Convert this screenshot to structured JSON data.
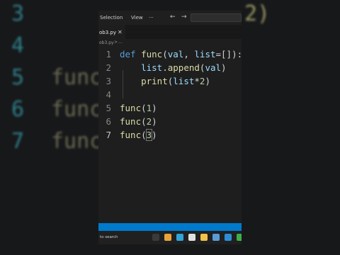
{
  "background": {
    "lines": [
      {
        "num": "3",
        "code": ""
      },
      {
        "num": "4",
        "code": ""
      },
      {
        "num": "5",
        "code": "func"
      },
      {
        "num": "6",
        "code": "func"
      },
      {
        "num": "7",
        "code": "func"
      }
    ],
    "tail_text": "2)"
  },
  "titlebar": {
    "menu": [
      "Selection",
      "View",
      "···"
    ],
    "nav_back": "←",
    "nav_forward": "→"
  },
  "tab": {
    "label": "ob3.py",
    "close": "✕"
  },
  "breadcrumb": {
    "file": "ob3.py",
    "sep": ">",
    "more": "..."
  },
  "editor": {
    "lines": [
      {
        "num": "1",
        "tokens": [
          [
            "kw",
            "def "
          ],
          [
            "fn",
            "func"
          ],
          [
            "pun",
            "("
          ],
          [
            "var",
            "val"
          ],
          [
            "pun",
            ", "
          ],
          [
            "var",
            "list"
          ],
          [
            "pun",
            "=[]):"
          ]
        ]
      },
      {
        "num": "2",
        "tokens": [
          [
            "pun",
            "    "
          ],
          [
            "var",
            "list"
          ],
          [
            "pun",
            "."
          ],
          [
            "fn",
            "append"
          ],
          [
            "pun",
            "("
          ],
          [
            "var",
            "val"
          ],
          [
            "pun",
            ")"
          ]
        ]
      },
      {
        "num": "3",
        "tokens": [
          [
            "pun",
            "    "
          ],
          [
            "fn",
            "print"
          ],
          [
            "pun",
            "("
          ],
          [
            "var",
            "list"
          ],
          [
            "pun",
            "*"
          ],
          [
            "num",
            "2"
          ],
          [
            "pun",
            ")"
          ]
        ]
      },
      {
        "num": "4",
        "tokens": []
      },
      {
        "num": "5",
        "tokens": [
          [
            "fn",
            "func"
          ],
          [
            "pun",
            "("
          ],
          [
            "num",
            "1"
          ],
          [
            "pun",
            ")"
          ]
        ]
      },
      {
        "num": "6",
        "tokens": [
          [
            "fn",
            "func"
          ],
          [
            "pun",
            "("
          ],
          [
            "num",
            "2"
          ],
          [
            "pun",
            ")"
          ]
        ]
      },
      {
        "num": "7",
        "tokens": [
          [
            "fn",
            "func"
          ],
          [
            "pun",
            "("
          ],
          [
            "num",
            "3"
          ],
          [
            "pun",
            ")"
          ]
        ]
      }
    ],
    "active_line": "7"
  },
  "taskbar": {
    "search_label": "to search",
    "icons": [
      {
        "name": "task-view-icon",
        "color": "#3a3a3a"
      },
      {
        "name": "photos-icon",
        "color": "#e8a33b"
      },
      {
        "name": "edge-icon",
        "color": "#2fa4d9"
      },
      {
        "name": "chrome-icon",
        "color": "#e0e0e0"
      },
      {
        "name": "folder-icon",
        "color": "#f0c24b"
      },
      {
        "name": "store-icon",
        "color": "#5a9bd5"
      },
      {
        "name": "vscode-icon",
        "color": "#2b8fd8"
      },
      {
        "name": "app-icon",
        "color": "#3fae49"
      }
    ]
  },
  "colors": {
    "statusbar": "#007acc",
    "accent": "#569cd6"
  }
}
